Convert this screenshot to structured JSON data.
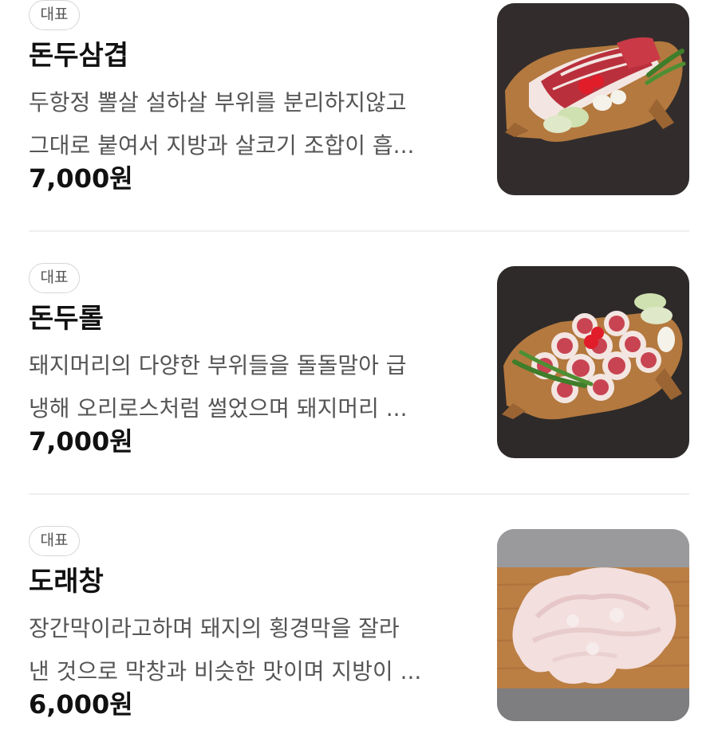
{
  "menu": {
    "items": [
      {
        "badge": "대표",
        "name": "돈두삼겹",
        "description_lines": [
          "두항정 뽈살 설하살 부위를 분리하지않고",
          "그대로 붙여서 지방과 살코기 조합이 흡..."
        ],
        "price": "7,000원",
        "image_icon": "pork-board-photo-icon"
      },
      {
        "badge": "대표",
        "name": "돈두롤",
        "description_lines": [
          "돼지머리의 다양한 부위들을 돌돌말아 급",
          "냉해 오리로스처럼 썰었으며 돼지머리 ..."
        ],
        "price": "7,000원",
        "image_icon": "pork-roll-board-photo-icon"
      },
      {
        "badge": "대표",
        "name": "도래창",
        "description_lines": [
          "장간막이라고하며 돼지의 횡경막을 잘라",
          "낸 것으로 막창과 비슷한 맛이며 지방이 ..."
        ],
        "price": "6,000원",
        "image_icon": "pork-intestine-board-photo-icon"
      }
    ]
  },
  "colors": {
    "text_primary": "#111111",
    "text_secondary": "#555555",
    "badge_border": "#d6d6d6",
    "divider": "#efefef",
    "photo_dark_bg": "#2e2a29",
    "photo_gray_bg": "#8c8c8e",
    "wood": "#b4793f",
    "meat_red": "#b9303c",
    "fat_white": "#f3e6e2"
  }
}
